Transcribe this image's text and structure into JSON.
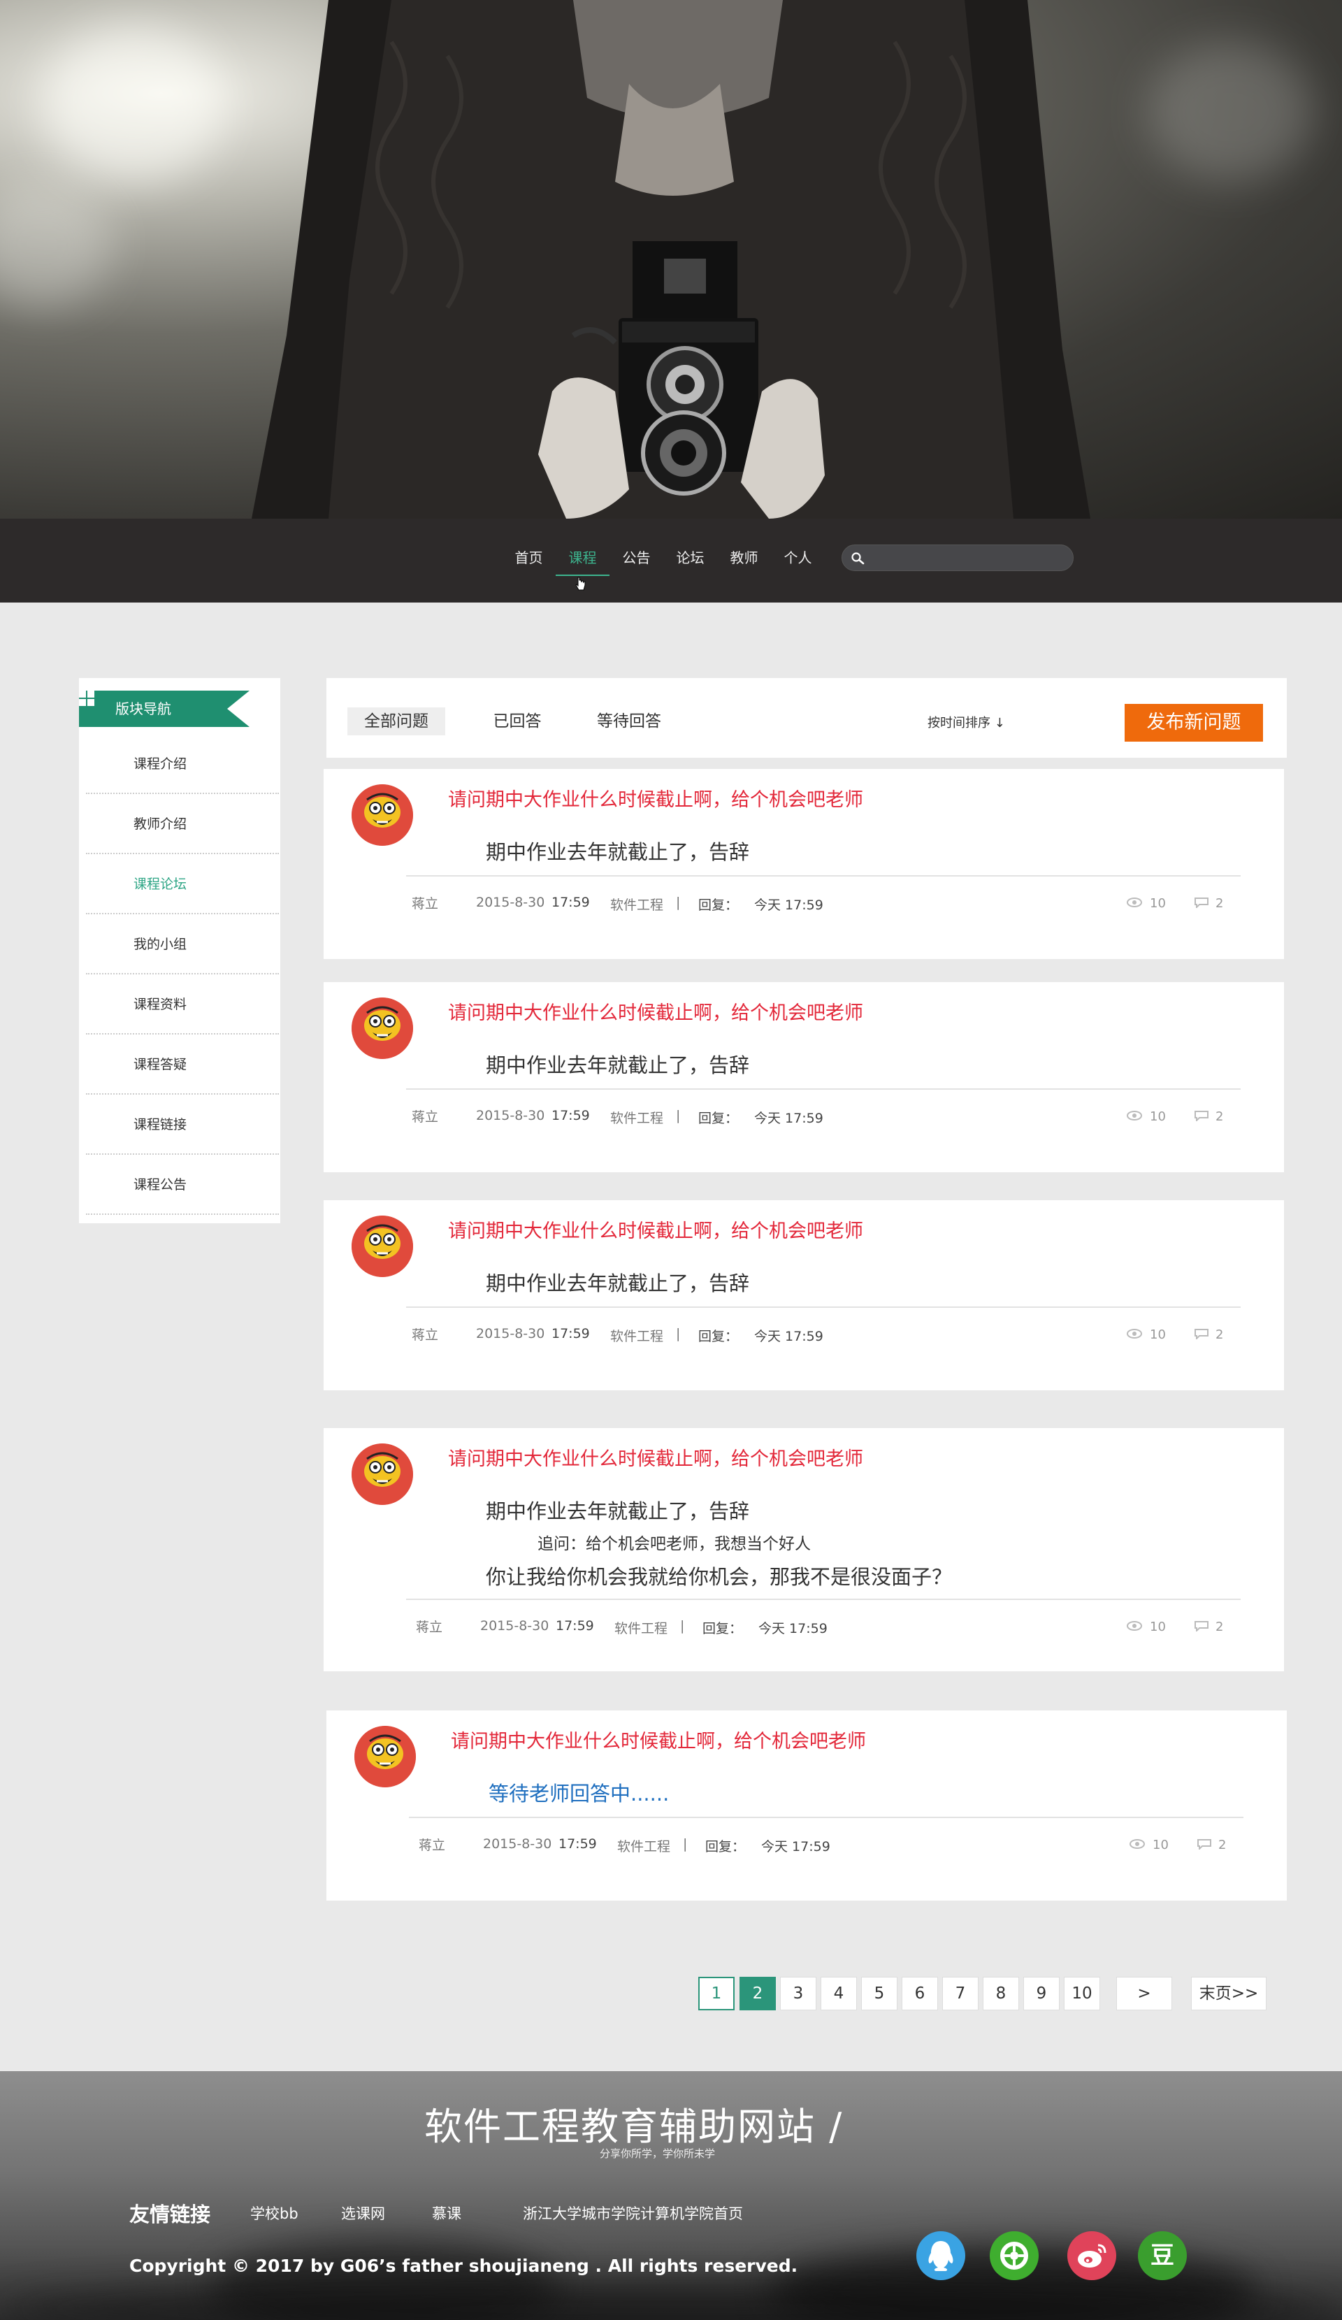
{
  "nav": {
    "items": [
      "首页",
      "课程",
      "公告",
      "论坛",
      "教师",
      "个人"
    ],
    "active_index": 1,
    "search_placeholder": ""
  },
  "sidebar": {
    "title": "版块导航",
    "items": [
      "课程介绍",
      "教师介绍",
      "课程论坛",
      "我的小组",
      "课程资料",
      "课程答疑",
      "课程链接",
      "课程公告"
    ],
    "active_index": 2
  },
  "filter": {
    "tabs": [
      "全部问题",
      "已回答",
      "等待回答"
    ],
    "active_index": 0,
    "sort_label": "按时间排序 ↓",
    "publish_label": "发布新问题"
  },
  "posts": [
    {
      "title": "请问期中大作业什么时候截止啊，给个机会吧老师",
      "reply": "期中作业去年就截止了，告辞",
      "author": "蒋立",
      "date": "2015-8-30",
      "time": "17:59",
      "course": "软件工程",
      "sep": "|",
      "reply_label": "回复：",
      "reply_time": "今天 17:59",
      "views": "10",
      "comments": "2"
    },
    {
      "title": "请问期中大作业什么时候截止啊，给个机会吧老师",
      "reply": "期中作业去年就截止了，告辞",
      "author": "蒋立",
      "date": "2015-8-30",
      "time": "17:59",
      "course": "软件工程",
      "sep": "|",
      "reply_label": "回复：",
      "reply_time": "今天 17:59",
      "views": "10",
      "comments": "2"
    },
    {
      "title": "请问期中大作业什么时候截止啊，给个机会吧老师",
      "reply": "期中作业去年就截止了，告辞",
      "author": "蒋立",
      "date": "2015-8-30",
      "time": "17:59",
      "course": "软件工程",
      "sep": "|",
      "reply_label": "回复：",
      "reply_time": "今天 17:59",
      "views": "10",
      "comments": "2"
    },
    {
      "title": "请问期中大作业什么时候截止啊，给个机会吧老师",
      "reply": "期中作业去年就截止了，告辞",
      "followup": "追问：给个机会吧老师，我想当个好人",
      "reply2": "你让我给你机会我就给你机会，那我不是很没面子？",
      "author": "蒋立",
      "date": "2015-8-30",
      "time": "17:59",
      "course": "软件工程",
      "sep": "|",
      "reply_label": "回复：",
      "reply_time": "今天 17:59",
      "views": "10",
      "comments": "2"
    },
    {
      "title": "请问期中大作业什么时候截止啊，给个机会吧老师",
      "waiting": "等待老师回答中......",
      "author": "蒋立",
      "date": "2015-8-30",
      "time": "17:59",
      "course": "软件工程",
      "sep": "|",
      "reply_label": "回复：",
      "reply_time": "今天 17:59",
      "views": "10",
      "comments": "2"
    }
  ],
  "pagination": {
    "pages": [
      "1",
      "2",
      "3",
      "4",
      "5",
      "6",
      "7",
      "8",
      "9",
      "10"
    ],
    "next": ">",
    "last": "末页>>",
    "current": "2"
  },
  "footer": {
    "site_name": "软件工程教育辅助网站 /",
    "slogan": "分享你所学，学你所未学",
    "links_label": "友情链接",
    "links": [
      "学校bb",
      "选课网",
      "慕课",
      "浙江大学城市学院计算机学院首页"
    ],
    "copyright": "Copyright © 2017 by G06’s father shoujianeng . All rights reserved.",
    "social": [
      {
        "name": "qq-icon",
        "color": "#3aa3e3"
      },
      {
        "name": "wechat-moments-icon",
        "color": "#3fae2f"
      },
      {
        "name": "weibo-icon",
        "color": "#e0435a"
      },
      {
        "name": "douban-icon",
        "color": "#3a9e2e",
        "glyph": "豆"
      }
    ]
  },
  "colors": {
    "accent_green": "#2b957a",
    "title_red": "#e3283a",
    "publish_orange": "#ef6a0c",
    "nav_bg": "#2d2a2a"
  }
}
